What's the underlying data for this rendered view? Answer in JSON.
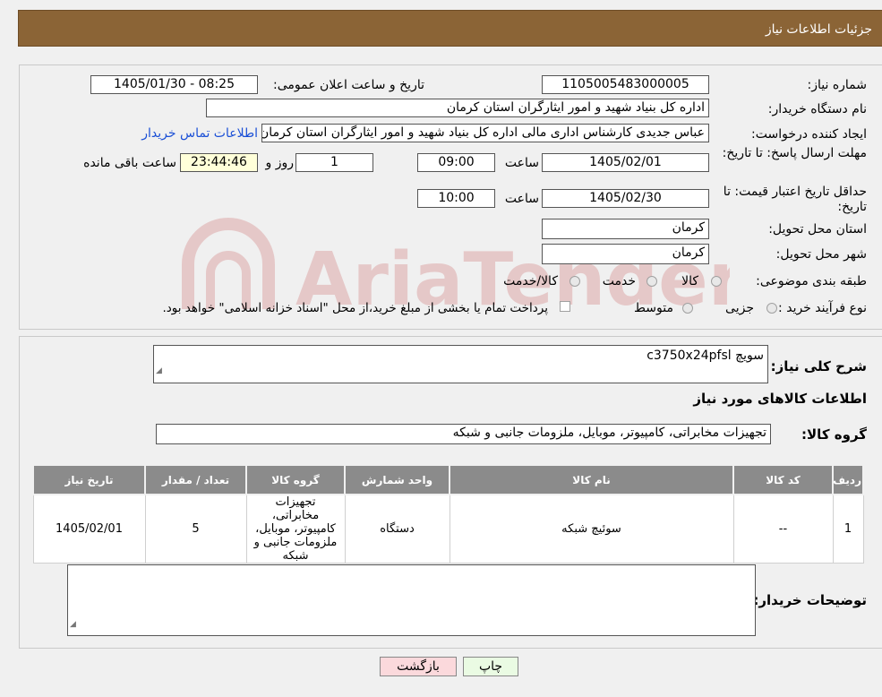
{
  "header": {
    "title": "جزئیات اطلاعات نیاز"
  },
  "fields": {
    "need_number_label": "شماره نیاز:",
    "need_number": "1105005483000005",
    "announce_label": "تاریخ و ساعت اعلان عمومی:",
    "announce_value": "1405/01/30 - 08:25",
    "buyer_org_label": "نام دستگاه خریدار:",
    "buyer_org": "اداره کل بنیاد شهید و امور ایثارگران استان کرمان",
    "requester_label": "ایجاد کننده درخواست:",
    "requester": "عباس جدیدی کارشناس اداری مالی اداره کل بنیاد شهید و امور ایثارگران استان کرمان",
    "contact_link": "اطلاعات تماس خریدار",
    "deadline_label": "مهلت ارسال پاسخ: تا تاریخ:",
    "deadline_date": "1405/02/01",
    "time_label": "ساعت",
    "deadline_time": "09:00",
    "days_value": "1",
    "days_label": "روز و",
    "remaining_time": "23:44:46",
    "remaining_label": "ساعت باقی مانده",
    "validity_label": "حداقل تاریخ اعتبار قیمت: تا تاریخ:",
    "validity_date": "1405/02/30",
    "validity_time": "10:00",
    "province_label": "استان محل تحویل:",
    "province": "کرمان",
    "city_label": "شهر محل تحویل:",
    "city": "کرمان",
    "category_label": "طبقه بندی موضوعی:",
    "category_options": [
      "کالا",
      "خدمت",
      "کالا/خدمت"
    ],
    "process_label": "نوع فرآیند خرید :",
    "process_options": [
      "جزیی",
      "متوسط"
    ],
    "payment_note": "پرداخت تمام یا بخشی از مبلغ خرید،از محل \"اسناد خزانه اسلامی\" خواهد بود."
  },
  "summary": {
    "desc_label": "شرح کلی نیاز:",
    "desc_value": "سویچ c3750x24pfsl",
    "goods_info_title": "اطلاعات کالاهای مورد نیاز",
    "group_label": "گروه کالا:",
    "group_value": "تجهیزات مخابراتی، کامپیوتر، موبایل، ملزومات جانبی و شبکه"
  },
  "table": {
    "headers": [
      "ردیف",
      "کد کالا",
      "نام کالا",
      "واحد شمارش",
      "گروه کالا",
      "تعداد / مقدار",
      "تاریخ نیاز"
    ],
    "rows": [
      [
        "1",
        "--",
        "سوئیچ شبکه",
        "دستگاه",
        "تجهیزات مخابراتی، کامپیوتر، موبایل، ملزومات جانبی و شبکه",
        "5",
        "1405/02/01"
      ]
    ]
  },
  "buyer_notes_label": "توضیحات خریدار:",
  "buttons": {
    "print": "چاپ",
    "back": "بازگشت"
  },
  "watermark_text": "AriaTender.neT",
  "colors": {
    "header": "#8b6436",
    "table_header": "#8b8b8b",
    "link": "#1a4fd6",
    "back_button": "#fbd9dc",
    "print_button": "#eafbe3"
  }
}
